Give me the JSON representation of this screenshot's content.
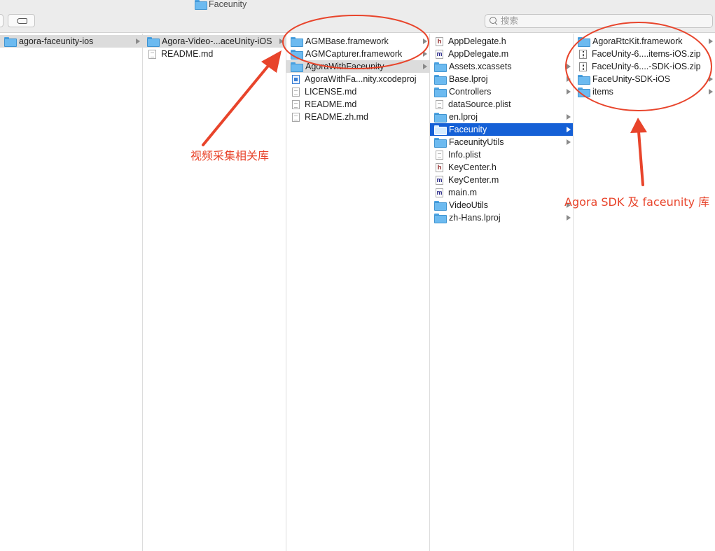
{
  "window": {
    "title": "Faceunity"
  },
  "toolbar": {
    "search_placeholder": "搜索"
  },
  "columns": [
    {
      "items": [
        {
          "name": "agora-faceunity-ios",
          "type": "folder",
          "state": "path",
          "has_children": true
        }
      ]
    },
    {
      "items": [
        {
          "name": "Agora-Video-...aceUnity-iOS",
          "type": "folder",
          "state": "path",
          "has_children": true
        },
        {
          "name": "README.md",
          "type": "doc",
          "state": "",
          "has_children": false
        }
      ]
    },
    {
      "items": [
        {
          "name": "AGMBase.framework",
          "type": "folder",
          "state": "",
          "has_children": true
        },
        {
          "name": "AGMCapturer.framework",
          "type": "folder",
          "state": "",
          "has_children": true
        },
        {
          "name": "AgoraWithFaceunity",
          "type": "folder",
          "state": "path",
          "has_children": true
        },
        {
          "name": "AgoraWithFa...nity.xcodeproj",
          "type": "proj",
          "state": "",
          "has_children": false
        },
        {
          "name": "LICENSE.md",
          "type": "doc",
          "state": "",
          "has_children": false
        },
        {
          "name": "README.md",
          "type": "doc",
          "state": "",
          "has_children": false
        },
        {
          "name": "README.zh.md",
          "type": "doc",
          "state": "",
          "has_children": false
        }
      ]
    },
    {
      "items": [
        {
          "name": "AppDelegate.h",
          "type": "h",
          "state": "",
          "has_children": false
        },
        {
          "name": "AppDelegate.m",
          "type": "m",
          "state": "",
          "has_children": false
        },
        {
          "name": "Assets.xcassets",
          "type": "folder",
          "state": "",
          "has_children": true
        },
        {
          "name": "Base.lproj",
          "type": "folder",
          "state": "",
          "has_children": true
        },
        {
          "name": "Controllers",
          "type": "folder",
          "state": "",
          "has_children": true
        },
        {
          "name": "dataSource.plist",
          "type": "doc",
          "state": "",
          "has_children": false
        },
        {
          "name": "en.lproj",
          "type": "folder",
          "state": "",
          "has_children": true
        },
        {
          "name": "Faceunity",
          "type": "folder",
          "state": "sel",
          "has_children": true
        },
        {
          "name": "FaceunityUtils",
          "type": "folder",
          "state": "",
          "has_children": true
        },
        {
          "name": "Info.plist",
          "type": "doc",
          "state": "",
          "has_children": false
        },
        {
          "name": "KeyCenter.h",
          "type": "h",
          "state": "",
          "has_children": false
        },
        {
          "name": "KeyCenter.m",
          "type": "m",
          "state": "",
          "has_children": false
        },
        {
          "name": "main.m",
          "type": "m",
          "state": "",
          "has_children": false
        },
        {
          "name": "VideoUtils",
          "type": "folder",
          "state": "",
          "has_children": true
        },
        {
          "name": "zh-Hans.lproj",
          "type": "folder",
          "state": "",
          "has_children": true
        }
      ]
    },
    {
      "items": [
        {
          "name": "AgoraRtcKit.framework",
          "type": "folder",
          "state": "",
          "has_children": true
        },
        {
          "name": "FaceUnity-6....items-iOS.zip",
          "type": "zip",
          "state": "",
          "has_children": false
        },
        {
          "name": "FaceUnity-6....-SDK-iOS.zip",
          "type": "zip",
          "state": "",
          "has_children": false
        },
        {
          "name": "FaceUnity-SDK-iOS",
          "type": "folder",
          "state": "",
          "has_children": true
        },
        {
          "name": "items",
          "type": "folder",
          "state": "",
          "has_children": true
        }
      ]
    }
  ],
  "annotations": {
    "left_label": "视频采集相关库",
    "right_label": "Agora SDK 及 faceunity 库",
    "color": "#e8442b"
  }
}
